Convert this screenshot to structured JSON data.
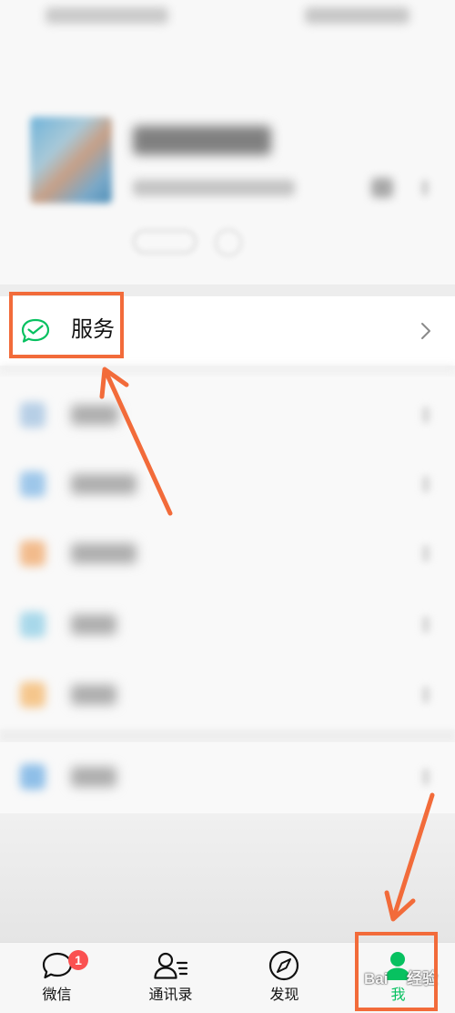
{
  "services_row": {
    "label": "服务",
    "icon": "wechat-pay-check-icon",
    "chevron_icon": "chevron-right-icon"
  },
  "tab_bar": {
    "tabs": [
      {
        "label": "微信",
        "icon": "chat-bubble-icon",
        "badge": "1",
        "active": false
      },
      {
        "label": "通讯录",
        "icon": "contacts-icon",
        "active": false
      },
      {
        "label": "发现",
        "icon": "compass-icon",
        "active": false
      },
      {
        "label": "我",
        "icon": "person-icon",
        "active": true
      }
    ]
  },
  "watermark": {
    "text_1": "Bai",
    "text_2": "经验"
  },
  "colors": {
    "accent": "#07c160",
    "annotation": "#f26b3a",
    "badge": "#fa5151"
  }
}
